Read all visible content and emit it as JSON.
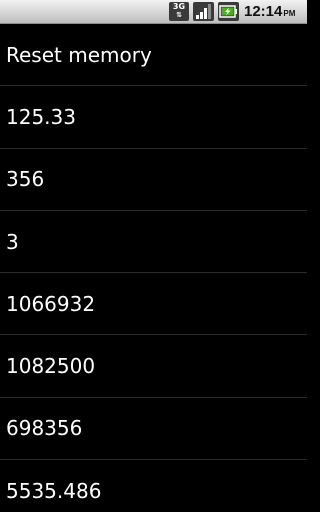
{
  "status_bar": {
    "network_icon": "3g-data-icon",
    "network_label": "3G",
    "signal_icon": "signal-strength-icon",
    "battery_icon": "battery-charging-icon",
    "time": "12:14",
    "ampm": "PM"
  },
  "list": {
    "items": [
      {
        "label": "Reset memory"
      },
      {
        "label": "125.33"
      },
      {
        "label": "356"
      },
      {
        "label": "3"
      },
      {
        "label": "1066932"
      },
      {
        "label": "1082500"
      },
      {
        "label": "698356"
      },
      {
        "label": "5535.486"
      }
    ]
  },
  "colors": {
    "background": "#000000",
    "text": "#ffffff",
    "divider": "#2a2a2a",
    "statusbar_top": "#f2f2f2",
    "statusbar_bottom": "#bdbdbd",
    "battery_charge": "#4caf1e"
  }
}
